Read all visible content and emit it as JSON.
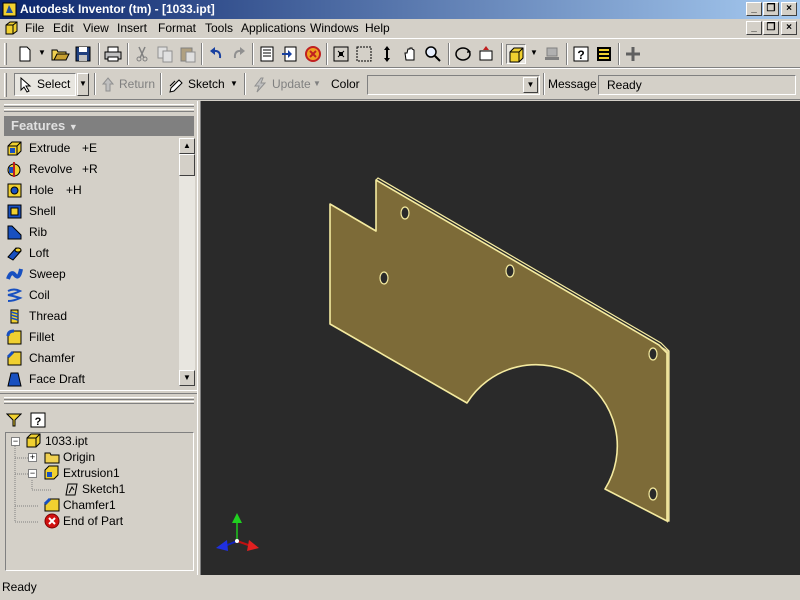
{
  "window": {
    "title": "Autodesk Inventor (tm) - [1033.ipt]",
    "caption_buttons": [
      "_",
      "▫",
      "×"
    ]
  },
  "menubar": {
    "items": [
      "File",
      "Edit",
      "View",
      "Insert",
      "Format",
      "Tools",
      "Applications",
      "Windows",
      "Help"
    ]
  },
  "command_bar": {
    "select_label": "Select",
    "return_label": "Return",
    "sketch_label": "Sketch",
    "update_label": "Update",
    "color_label": "Color",
    "color_value": "",
    "message_label": "Message",
    "message_value": "Ready"
  },
  "features": {
    "header": "Features",
    "items": [
      {
        "label": "Extrude",
        "shortcut": "+E",
        "icon": "extrude-icon"
      },
      {
        "label": "Revolve",
        "shortcut": "+R",
        "icon": "revolve-icon"
      },
      {
        "label": "Hole",
        "shortcut": "+H",
        "icon": "hole-icon"
      },
      {
        "label": "Shell",
        "shortcut": "",
        "icon": "shell-icon"
      },
      {
        "label": "Rib",
        "shortcut": "",
        "icon": "rib-icon"
      },
      {
        "label": "Loft",
        "shortcut": "",
        "icon": "loft-icon"
      },
      {
        "label": "Sweep",
        "shortcut": "",
        "icon": "sweep-icon"
      },
      {
        "label": "Coil",
        "shortcut": "",
        "icon": "coil-icon"
      },
      {
        "label": "Thread",
        "shortcut": "",
        "icon": "thread-icon"
      },
      {
        "label": "Fillet",
        "shortcut": "",
        "icon": "fillet-icon"
      },
      {
        "label": "Chamfer",
        "shortcut": "",
        "icon": "chamfer-icon"
      },
      {
        "label": "Face Draft",
        "shortcut": "",
        "icon": "face-draft-icon"
      }
    ]
  },
  "browser": {
    "nodes": [
      {
        "label": "1033.ipt",
        "icon": "part-icon"
      },
      {
        "label": "Origin",
        "icon": "folder-icon"
      },
      {
        "label": "Extrusion1",
        "icon": "extrude-icon"
      },
      {
        "label": "Sketch1",
        "icon": "sketch-icon"
      },
      {
        "label": "Chamfer1",
        "icon": "chamfer-icon"
      },
      {
        "label": "End of Part",
        "icon": "end-of-part-icon"
      }
    ]
  },
  "status": {
    "text": "Ready"
  },
  "colors": {
    "viewport_bg": "#2a2a2a",
    "part_face": "#7d6b38",
    "part_edge": "#f5eba0",
    "title_start": "#0a246a",
    "title_end": "#a6caf0"
  }
}
